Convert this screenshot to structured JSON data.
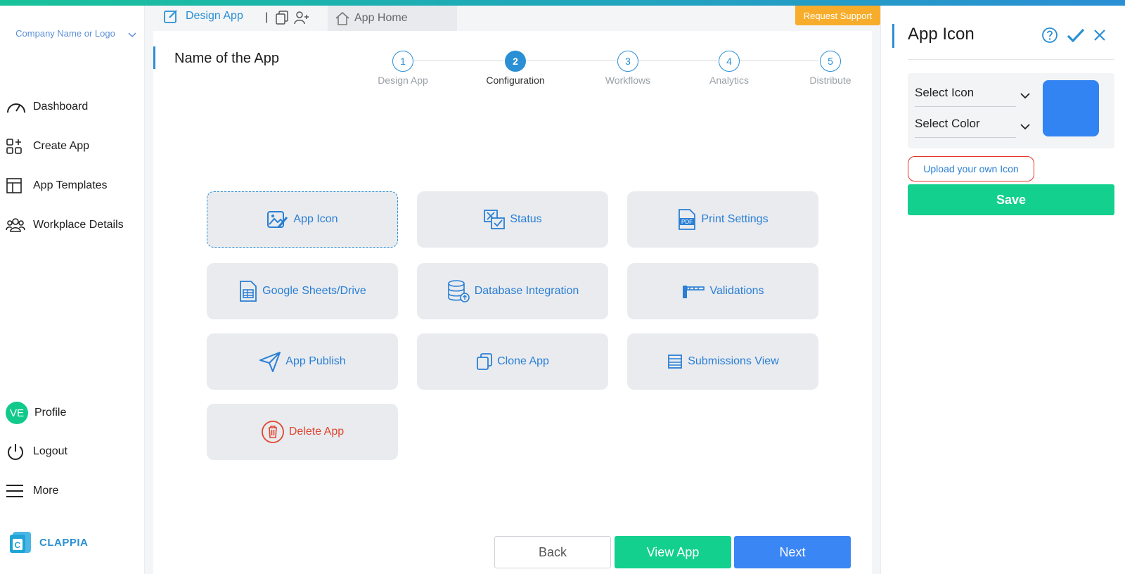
{
  "sidebar": {
    "company": "Company Name or Logo",
    "items": [
      {
        "label": "Dashboard"
      },
      {
        "label": "Create App"
      },
      {
        "label": "App Templates"
      },
      {
        "label": "Workplace Details"
      }
    ],
    "profile": {
      "initials": "VE",
      "label": "Profile"
    },
    "logout": "Logout",
    "more": "More",
    "brand": "CLAPPIA"
  },
  "tabs": {
    "design": "Design App",
    "separator": "|",
    "home": "App Home",
    "support": "Request Support"
  },
  "main": {
    "app_name": "Name of the App",
    "steps": [
      {
        "num": "1",
        "label": "Design App"
      },
      {
        "num": "2",
        "label": "Configuration"
      },
      {
        "num": "3",
        "label": "Workflows"
      },
      {
        "num": "4",
        "label": "Analytics"
      },
      {
        "num": "5",
        "label": "Distribute"
      }
    ],
    "active_step": 2,
    "cards": [
      {
        "label": "App Icon",
        "icon": "image-edit-icon"
      },
      {
        "label": "Status",
        "icon": "status-check-icon"
      },
      {
        "label": "Print Settings",
        "icon": "pdf-icon"
      },
      {
        "label": "Google Sheets/Drive",
        "icon": "sheet-icon"
      },
      {
        "label": "Database Integration",
        "icon": "database-icon"
      },
      {
        "label": "Validations",
        "icon": "barrier-icon"
      },
      {
        "label": "App Publish",
        "icon": "paper-plane-icon"
      },
      {
        "label": "Clone App",
        "icon": "copy-icon"
      },
      {
        "label": "Submissions View",
        "icon": "list-icon"
      },
      {
        "label": "Delete App",
        "icon": "trash-icon"
      }
    ],
    "buttons": {
      "back": "Back",
      "view": "View App",
      "next": "Next"
    }
  },
  "panel": {
    "title": "App Icon",
    "select_icon": "Select Icon",
    "select_color": "Select Color",
    "selected_color": "#3284f2",
    "upload": "Upload your own Icon",
    "save": "Save"
  },
  "colors": {
    "accent": "#2a8fd4",
    "success": "#13d08f",
    "primary": "#3b86f5",
    "warning": "#f7ad2b",
    "danger": "#e0452f"
  }
}
